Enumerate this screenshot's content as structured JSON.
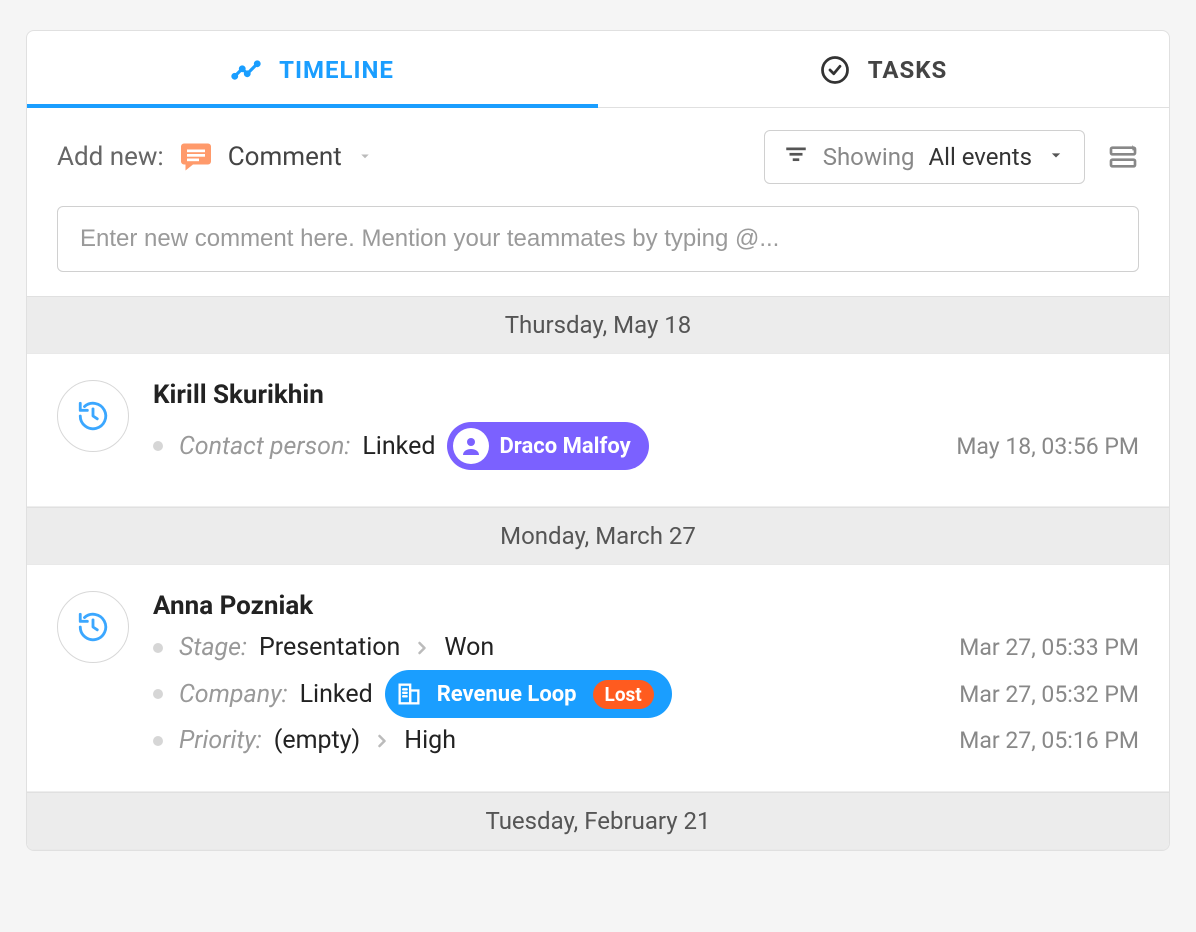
{
  "tabs": {
    "timeline_label": "TIMELINE",
    "tasks_label": "TASKS"
  },
  "toolbar": {
    "add_new_label": "Add new:",
    "comment_label": "Comment",
    "showing_label": "Showing",
    "showing_value": "All events"
  },
  "input": {
    "placeholder": "Enter new comment here. Mention your teammates by typing @..."
  },
  "groups": [
    {
      "date_label": "Thursday, May 18",
      "entries": [
        {
          "user": "Kirill Skurikhin",
          "rows": [
            {
              "field": "Contact person:",
              "action": "Linked",
              "pill": {
                "kind": "purple",
                "label": "Draco Malfoy",
                "icon": "person"
              },
              "time": "May 18, 03:56 PM"
            }
          ]
        }
      ]
    },
    {
      "date_label": "Monday, March 27",
      "entries": [
        {
          "user": "Anna Pozniak",
          "rows": [
            {
              "field": "Stage:",
              "from": "Presentation",
              "to": "Won",
              "time": "Mar 27, 05:33 PM"
            },
            {
              "field": "Company:",
              "action": "Linked",
              "pill": {
                "kind": "blue",
                "label": "Revenue Loop",
                "icon": "building",
                "status": "Lost"
              },
              "time": "Mar 27, 05:32 PM"
            },
            {
              "field": "Priority:",
              "from": "(empty)",
              "to": "High",
              "time": "Mar 27, 05:16 PM"
            }
          ]
        }
      ]
    },
    {
      "date_label": "Tuesday, February 21",
      "entries": []
    }
  ]
}
